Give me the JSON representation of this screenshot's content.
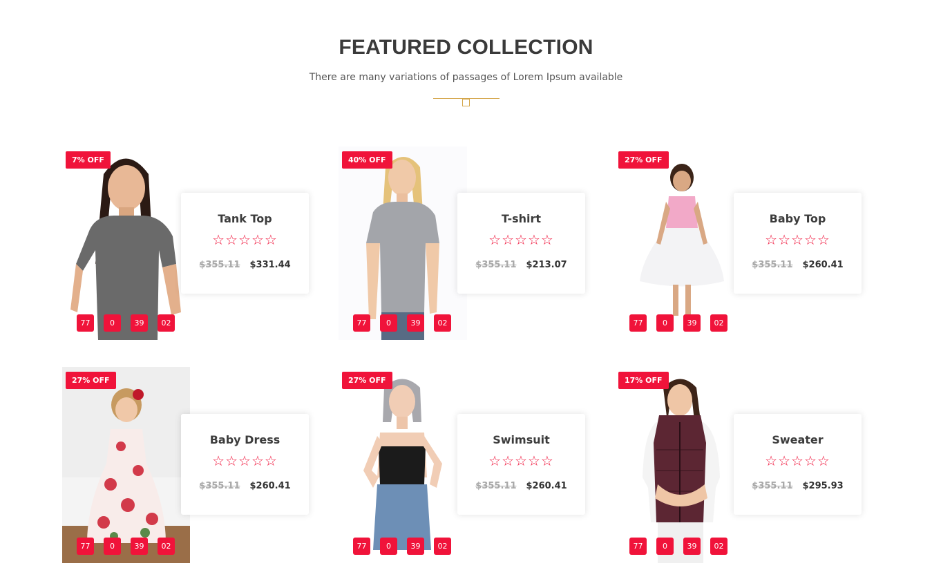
{
  "section": {
    "title": "FEATURED COLLECTION",
    "subtitle": "There are many variations of passages of Lorem Ipsum available"
  },
  "products": [
    {
      "name": "Tank Top",
      "discount": "7% OFF",
      "old_price": "$355.11",
      "new_price": "$331.44",
      "rating_stars": "☆☆☆☆☆",
      "countdown": [
        "77",
        "0",
        "39",
        "02"
      ]
    },
    {
      "name": "T-shirt",
      "discount": "40% OFF",
      "old_price": "$355.11",
      "new_price": "$213.07",
      "rating_stars": "☆☆☆☆☆",
      "countdown": [
        "77",
        "0",
        "39",
        "02"
      ]
    },
    {
      "name": "Baby Top",
      "discount": "27% OFF",
      "old_price": "$355.11",
      "new_price": "$260.41",
      "rating_stars": "☆☆☆☆☆",
      "countdown": [
        "77",
        "0",
        "39",
        "02"
      ]
    },
    {
      "name": "Baby Dress",
      "discount": "27% OFF",
      "old_price": "$355.11",
      "new_price": "$260.41",
      "rating_stars": "☆☆☆☆☆",
      "countdown": [
        "77",
        "0",
        "39",
        "02"
      ]
    },
    {
      "name": "Swimsuit",
      "discount": "27% OFF",
      "old_price": "$355.11",
      "new_price": "$260.41",
      "rating_stars": "☆☆☆☆☆",
      "countdown": [
        "77",
        "0",
        "39",
        "02"
      ]
    },
    {
      "name": "Sweater",
      "discount": "17% OFF",
      "old_price": "$355.11",
      "new_price": "$295.93",
      "rating_stars": "☆☆☆☆☆",
      "countdown": [
        "77",
        "0",
        "39",
        "02"
      ]
    }
  ],
  "colors": {
    "accent": "#f0133a",
    "divider": "#d4a64a",
    "heading": "#3a3a3a"
  },
  "icons": {
    "rating": "star-outline-icon"
  }
}
